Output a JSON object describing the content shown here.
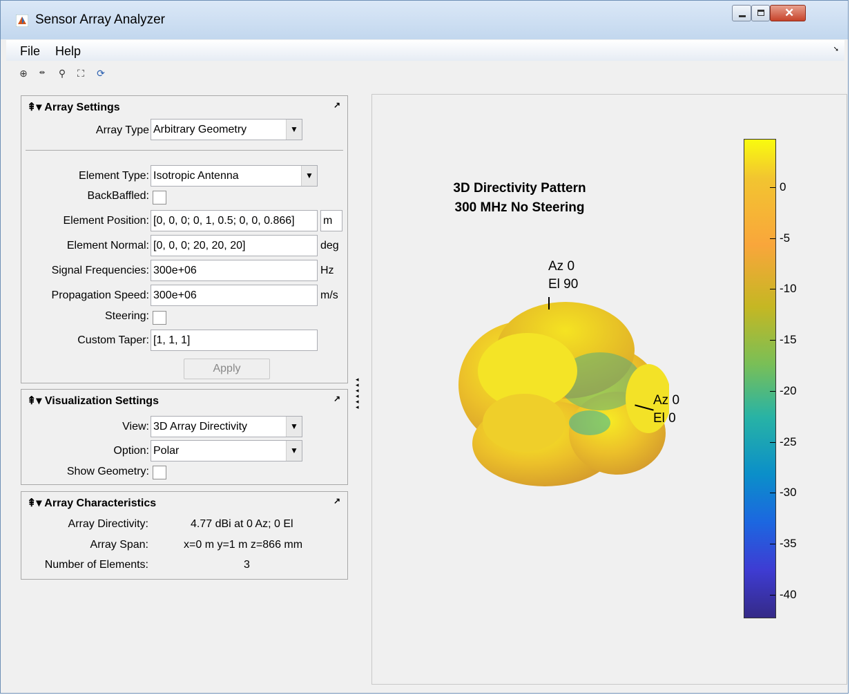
{
  "window": {
    "title": "Sensor Array Analyzer"
  },
  "menu": {
    "file": "File",
    "help": "Help"
  },
  "toolbar": {
    "icons": [
      "zoom-in-icon",
      "zoom-out-icon",
      "pan-icon",
      "zoom-extents-icon",
      "rotate-icon"
    ]
  },
  "array_settings": {
    "title": "Array Settings",
    "array_type_label": "Array Type",
    "array_type_value": "Arbitrary Geometry",
    "element_type_label": "Element Type:",
    "element_type_value": "Isotropic Antenna",
    "backbaffled_label": "BackBaffled:",
    "element_position_label": "Element Position:",
    "element_position_value": "[0, 0, 0; 0, 1, 0.5; 0, 0, 0.866]",
    "element_position_unit": "m",
    "element_normal_label": "Element Normal:",
    "element_normal_value": "[0, 0, 0; 20, 20, 20]",
    "element_normal_unit": "deg",
    "signal_freq_label": "Signal Frequencies:",
    "signal_freq_value": "300e+06",
    "signal_freq_unit": "Hz",
    "prop_speed_label": "Propagation Speed:",
    "prop_speed_value": "300e+06",
    "prop_speed_unit": "m/s",
    "steering_label": "Steering:",
    "custom_taper_label": "Custom Taper:",
    "custom_taper_value": "[1, 1, 1]",
    "apply_label": "Apply"
  },
  "visualization_settings": {
    "title": "Visualization Settings",
    "view_label": "View:",
    "view_value": "3D Array Directivity",
    "option_label": "Option:",
    "option_value": "Polar",
    "show_geometry_label": "Show Geometry:"
  },
  "array_characteristics": {
    "title": "Array Characteristics",
    "directivity_label": "Array Directivity:",
    "directivity_value": "4.77 dBi at 0 Az; 0 El",
    "span_label": "Array Span:",
    "span_value": "x=0 m y=1 m z=866 mm",
    "num_elements_label": "Number of Elements:",
    "num_elements_value": "3"
  },
  "plot": {
    "title_line1": "3D Directivity Pattern",
    "title_line2": "300 MHz No Steering",
    "label_top_az": "Az 0",
    "label_top_el": "El 90",
    "label_side_az": "Az 0",
    "label_side_el": "El 0"
  },
  "colorbar": {
    "ticks": [
      "0",
      "-5",
      "-10",
      "-15",
      "-20",
      "-25",
      "-30",
      "-35",
      "-40"
    ],
    "colors": {
      "top": "#f9fb0e",
      "bottom": "#352a87"
    }
  }
}
